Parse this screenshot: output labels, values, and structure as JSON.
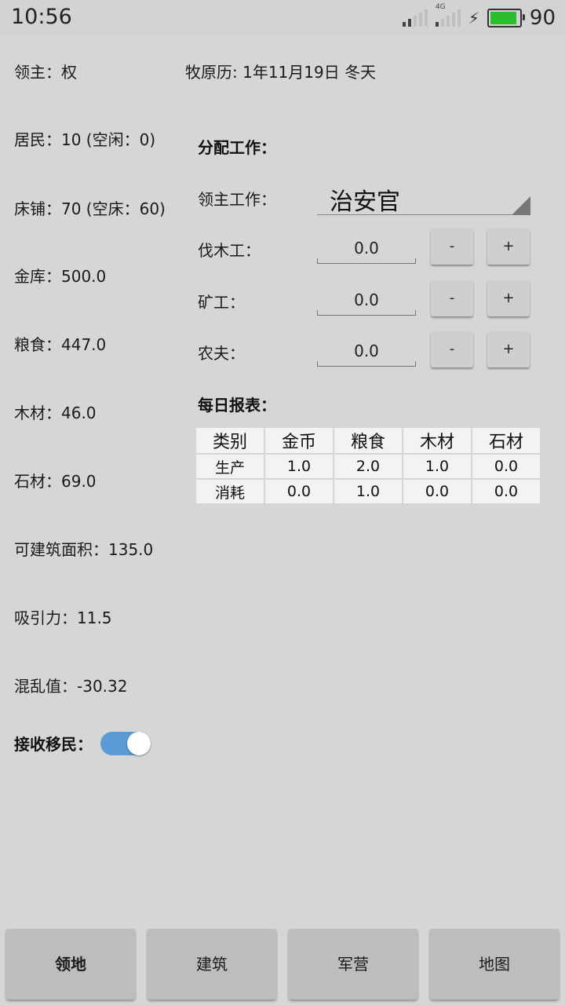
{
  "status_bar": {
    "time": "10:56",
    "network_label": "4G",
    "battery": "90",
    "battery_color": "#2bbd2b"
  },
  "lord": "领主：权",
  "calendar": "牧原历: 1年11月19日  冬天",
  "stats": [
    "居民：10 (空闲：0)",
    "床铺：70 (空床：60)",
    "金库：500.0",
    "粮食：447.0",
    "木材：46.0",
    "石材：69.0",
    "可建筑面积：135.0",
    "吸引力：11.5",
    "混乱值：-30.32"
  ],
  "immigration": {
    "label": "接收移民：",
    "enabled": true,
    "accent": "#5a9ad6"
  },
  "assign": {
    "header": "分配工作：",
    "lord_job_label": "领主工作：",
    "lord_job_value": "治安官",
    "workers": [
      {
        "label": "伐木工：",
        "value": "0.0",
        "minus": "-",
        "plus": "+"
      },
      {
        "label": "矿工：",
        "value": "0.0",
        "minus": "-",
        "plus": "+"
      },
      {
        "label": "农夫：",
        "value": "0.0",
        "minus": "-",
        "plus": "+"
      }
    ]
  },
  "report": {
    "header": "每日报表：",
    "columns": [
      "类别",
      "金币",
      "粮食",
      "木材",
      "石材"
    ],
    "rows": [
      [
        "生产",
        "1.0",
        "2.0",
        "1.0",
        "0.0"
      ],
      [
        "消耗",
        "0.0",
        "1.0",
        "0.0",
        "0.0"
      ]
    ]
  },
  "nav": {
    "tabs": [
      "领地",
      "建筑",
      "军营",
      "地图"
    ],
    "active": "领地"
  }
}
